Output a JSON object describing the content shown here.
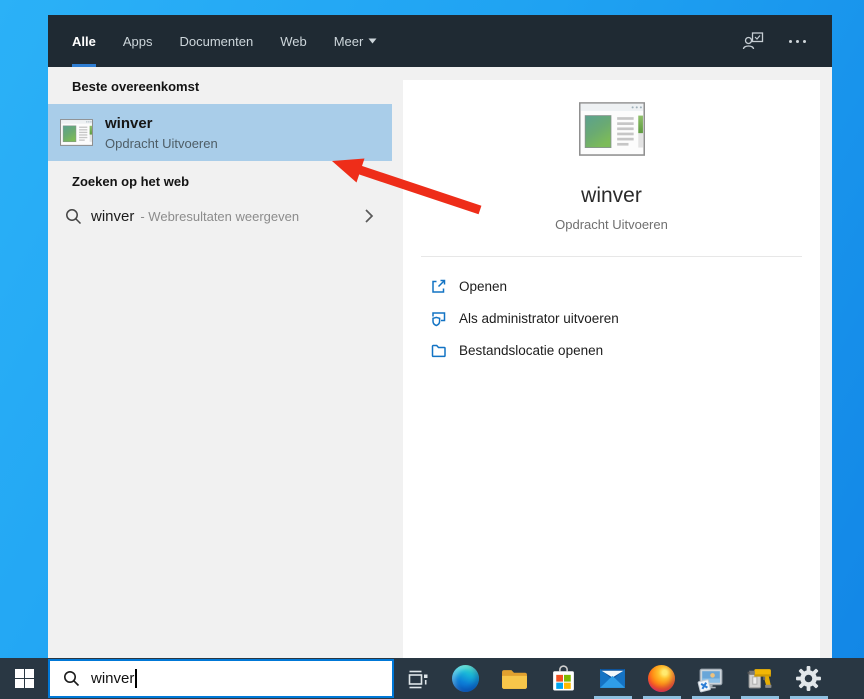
{
  "header": {
    "tabs": [
      {
        "label": "Alle",
        "active": true
      },
      {
        "label": "Apps",
        "active": false
      },
      {
        "label": "Documenten",
        "active": false
      },
      {
        "label": "Web",
        "active": false
      },
      {
        "label": "Meer",
        "active": false,
        "dropdown": true
      }
    ],
    "icons": [
      "feedback-account-icon",
      "more-options-icon"
    ]
  },
  "left_panel": {
    "best_match_header": "Beste overeenkomst",
    "best_match": {
      "title": "winver",
      "subtitle": "Opdracht Uitvoeren",
      "icon": "winver-window-icon"
    },
    "web_search_header": "Zoeken op het web",
    "web_result": {
      "query": "winver",
      "description": "- Webresultaten weergeven",
      "icon": "search-icon"
    }
  },
  "right_panel": {
    "app_title": "winver",
    "app_subtitle": "Opdracht Uitvoeren",
    "app_icon": "winver-window-icon",
    "actions": [
      {
        "icon": "open-icon",
        "label": "Openen"
      },
      {
        "icon": "run-as-admin-icon",
        "label": "Als administrator uitvoeren"
      },
      {
        "icon": "open-file-location-icon",
        "label": "Bestandslocatie openen"
      }
    ]
  },
  "taskbar": {
    "search_value": "winver",
    "start": "start-button",
    "apps": [
      {
        "icon": "edge-icon",
        "running": false
      },
      {
        "icon": "file-explorer-icon",
        "running": false
      },
      {
        "icon": "microsoft-store-icon",
        "running": false
      },
      {
        "icon": "mail-icon",
        "running": true
      },
      {
        "icon": "firefox-icon",
        "running": true
      },
      {
        "icon": "remote-app-icon",
        "running": true
      },
      {
        "icon": "installer-tool-icon",
        "running": true
      },
      {
        "icon": "settings-icon",
        "running": true
      }
    ]
  },
  "annotation": {
    "type": "red-arrow",
    "color": "#ee2d19",
    "target": "best-match-result"
  },
  "colors": {
    "desktop_top": "#2bb1f7",
    "desktop_bottom": "#1286e6",
    "header_bg": "#1f2a33",
    "taskbar_bg": "#293743",
    "accent": "#0078d7",
    "tab_underline": "#2e7dd2",
    "highlight": "#a9cde9",
    "panel_bg": "#f1f1f1",
    "action_icon_blue": "#1273c4",
    "running_indicator": "#8fc0e0"
  }
}
